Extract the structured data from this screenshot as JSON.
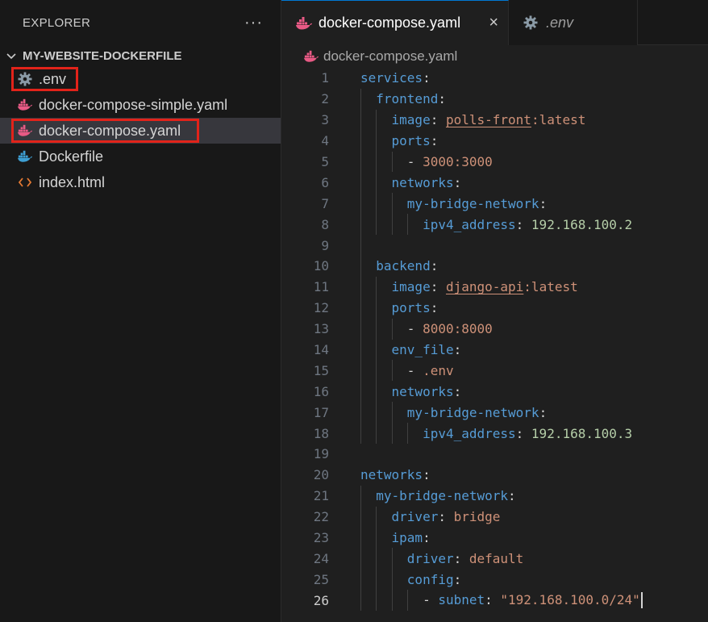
{
  "sidebar": {
    "title": "EXPLORER",
    "more_icon": "ellipsis-icon",
    "folder": "MY-WEBSITE-DOCKERFILE",
    "files": [
      {
        "name": ".env",
        "icon": "gear-icon",
        "highlighted": true,
        "selected": false
      },
      {
        "name": "docker-compose-simple.yaml",
        "icon": "docker-icon",
        "highlighted": false,
        "selected": false
      },
      {
        "name": "docker-compose.yaml",
        "icon": "docker-icon",
        "highlighted": true,
        "selected": true
      },
      {
        "name": "Dockerfile",
        "icon": "docker-icon",
        "highlighted": false,
        "selected": false
      },
      {
        "name": "index.html",
        "icon": "html-brackets-icon",
        "highlighted": false,
        "selected": false
      }
    ]
  },
  "tabs": [
    {
      "label": "docker-compose.yaml",
      "icon": "docker-icon",
      "active": true,
      "close": "×"
    },
    {
      "label": ".env",
      "icon": "gear-icon",
      "active": false
    }
  ],
  "breadcrumb": {
    "file": "docker-compose.yaml"
  },
  "editor": {
    "current_line": 26,
    "lines": [
      {
        "num": "1",
        "tokens": [
          [
            "k",
            "services"
          ],
          [
            "p",
            ":"
          ]
        ]
      },
      {
        "num": "2",
        "tokens": [
          [
            "p",
            "  "
          ],
          [
            "k",
            "frontend"
          ],
          [
            "p",
            ":"
          ]
        ]
      },
      {
        "num": "3",
        "tokens": [
          [
            "p",
            "    "
          ],
          [
            "k",
            "image"
          ],
          [
            "p",
            ": "
          ],
          [
            "su",
            "polls-front"
          ],
          [
            "s",
            ":latest"
          ]
        ]
      },
      {
        "num": "4",
        "tokens": [
          [
            "p",
            "    "
          ],
          [
            "k",
            "ports"
          ],
          [
            "p",
            ":"
          ]
        ]
      },
      {
        "num": "5",
        "tokens": [
          [
            "p",
            "      - "
          ],
          [
            "s",
            "3000:3000"
          ]
        ]
      },
      {
        "num": "6",
        "tokens": [
          [
            "p",
            "    "
          ],
          [
            "k",
            "networks"
          ],
          [
            "p",
            ":"
          ]
        ]
      },
      {
        "num": "7",
        "tokens": [
          [
            "p",
            "      "
          ],
          [
            "k",
            "my-bridge-network"
          ],
          [
            "p",
            ":"
          ]
        ]
      },
      {
        "num": "8",
        "tokens": [
          [
            "p",
            "        "
          ],
          [
            "k",
            "ipv4_address"
          ],
          [
            "p",
            ": "
          ],
          [
            "n",
            "192.168.100.2"
          ]
        ]
      },
      {
        "num": "9",
        "tokens": []
      },
      {
        "num": "10",
        "tokens": [
          [
            "p",
            "  "
          ],
          [
            "k",
            "backend"
          ],
          [
            "p",
            ":"
          ]
        ]
      },
      {
        "num": "11",
        "tokens": [
          [
            "p",
            "    "
          ],
          [
            "k",
            "image"
          ],
          [
            "p",
            ": "
          ],
          [
            "su",
            "django-api"
          ],
          [
            "s",
            ":latest"
          ]
        ]
      },
      {
        "num": "12",
        "tokens": [
          [
            "p",
            "    "
          ],
          [
            "k",
            "ports"
          ],
          [
            "p",
            ":"
          ]
        ]
      },
      {
        "num": "13",
        "tokens": [
          [
            "p",
            "      - "
          ],
          [
            "s",
            "8000:8000"
          ]
        ]
      },
      {
        "num": "14",
        "tokens": [
          [
            "p",
            "    "
          ],
          [
            "k",
            "env_file"
          ],
          [
            "p",
            ":"
          ]
        ]
      },
      {
        "num": "15",
        "tokens": [
          [
            "p",
            "      - "
          ],
          [
            "s",
            ".env"
          ]
        ]
      },
      {
        "num": "16",
        "tokens": [
          [
            "p",
            "    "
          ],
          [
            "k",
            "networks"
          ],
          [
            "p",
            ":"
          ]
        ]
      },
      {
        "num": "17",
        "tokens": [
          [
            "p",
            "      "
          ],
          [
            "k",
            "my-bridge-network"
          ],
          [
            "p",
            ":"
          ]
        ]
      },
      {
        "num": "18",
        "tokens": [
          [
            "p",
            "        "
          ],
          [
            "k",
            "ipv4_address"
          ],
          [
            "p",
            ": "
          ],
          [
            "n",
            "192.168.100.3"
          ]
        ]
      },
      {
        "num": "19",
        "tokens": []
      },
      {
        "num": "20",
        "tokens": [
          [
            "k",
            "networks"
          ],
          [
            "p",
            ":"
          ]
        ]
      },
      {
        "num": "21",
        "tokens": [
          [
            "p",
            "  "
          ],
          [
            "k",
            "my-bridge-network"
          ],
          [
            "p",
            ":"
          ]
        ]
      },
      {
        "num": "22",
        "tokens": [
          [
            "p",
            "    "
          ],
          [
            "k",
            "driver"
          ],
          [
            "p",
            ": "
          ],
          [
            "s",
            "bridge"
          ]
        ]
      },
      {
        "num": "23",
        "tokens": [
          [
            "p",
            "    "
          ],
          [
            "k",
            "ipam"
          ],
          [
            "p",
            ":"
          ]
        ]
      },
      {
        "num": "24",
        "tokens": [
          [
            "p",
            "      "
          ],
          [
            "k",
            "driver"
          ],
          [
            "p",
            ": "
          ],
          [
            "s",
            "default"
          ]
        ]
      },
      {
        "num": "25",
        "tokens": [
          [
            "p",
            "      "
          ],
          [
            "k",
            "config"
          ],
          [
            "p",
            ":"
          ]
        ]
      },
      {
        "num": "26",
        "tokens": [
          [
            "p",
            "        - "
          ],
          [
            "k",
            "subnet"
          ],
          [
            "p",
            ": "
          ],
          [
            "s",
            "\"192.168.100.0/24\""
          ]
        ]
      }
    ]
  },
  "colors": {
    "docker_icon": "#e85a85",
    "dockerfile_icon": "#3e9fd3",
    "gear_icon": "#8a9aa6",
    "html_icon": "#e37933",
    "highlight_box": "#e2231a",
    "keyword": "#569cd6",
    "string": "#ce9178",
    "number": "#b5cea8"
  }
}
